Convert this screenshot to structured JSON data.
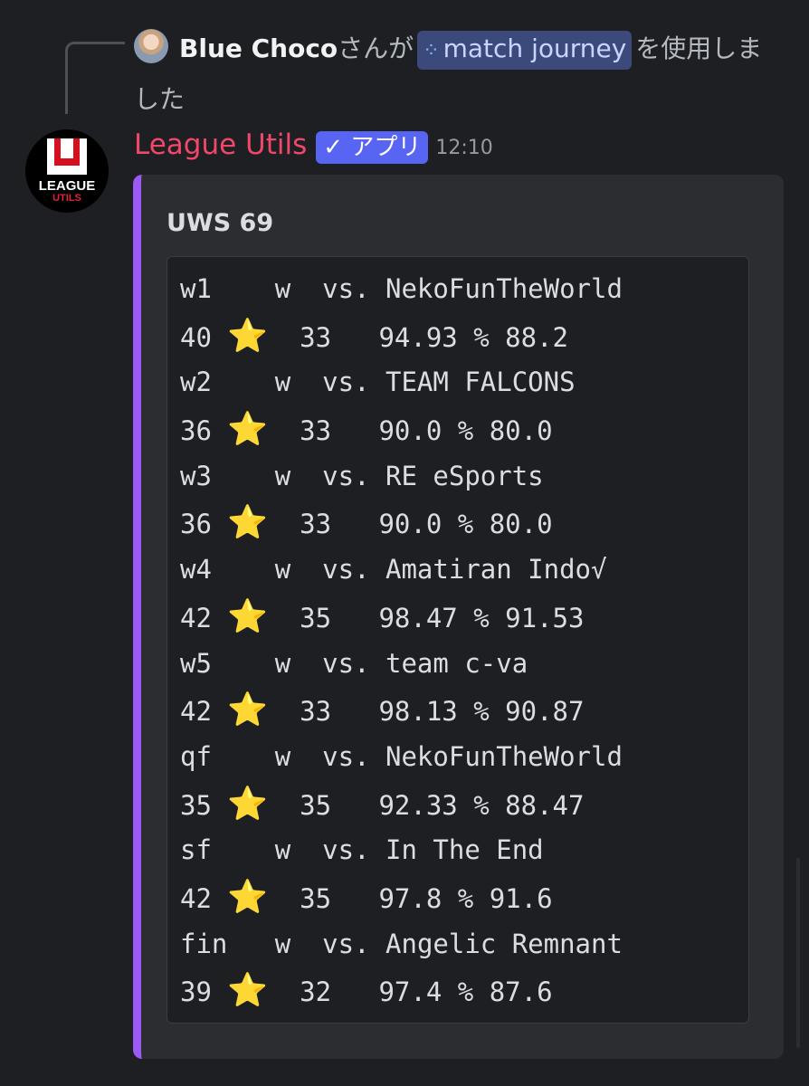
{
  "reply": {
    "avatar_icon": "user-avatar",
    "user": "Blue Choco",
    "prefix": "さんが",
    "command": "match journey",
    "command_icon": "slash-command-icon",
    "suffix": "を使用しました"
  },
  "message": {
    "bot_name": "League Utils",
    "app_tag_check": "✓",
    "app_tag": "アプリ",
    "time": "12:10",
    "avatar_text1": "LEAGUE",
    "avatar_text2": "UTILS",
    "bot_color": "#f0476a"
  },
  "embed": {
    "accent_color": "#9b59f5",
    "title": "UWS 69",
    "star_icon": "⭐",
    "rows": [
      {
        "round": "w1",
        "result": "w",
        "vs": "vs.",
        "opponent": "NekoFunTheWorld",
        "score": "40",
        "second": "33",
        "pct": "94.93 %",
        "last": "88.2"
      },
      {
        "round": "w2",
        "result": "w",
        "vs": "vs.",
        "opponent": "TEAM FALCONS",
        "score": "36",
        "second": "33",
        "pct": "90.0 %",
        "last": "80.0"
      },
      {
        "round": "w3",
        "result": "w",
        "vs": "vs.",
        "opponent": "RE eSports",
        "score": "36",
        "second": "33",
        "pct": "90.0 %",
        "last": "80.0"
      },
      {
        "round": "w4",
        "result": "w",
        "vs": "vs.",
        "opponent": "Amatiran Indo√",
        "score": "42",
        "second": "35",
        "pct": "98.47 %",
        "last": "91.53"
      },
      {
        "round": "w5",
        "result": "w",
        "vs": "vs.",
        "opponent": "team c-va",
        "score": "42",
        "second": "33",
        "pct": "98.13 %",
        "last": "90.87"
      },
      {
        "round": "qf",
        "result": "w",
        "vs": "vs.",
        "opponent": "NekoFunTheWorld",
        "score": "35",
        "second": "35",
        "pct": "92.33 %",
        "last": "88.47"
      },
      {
        "round": "sf",
        "result": "w",
        "vs": "vs.",
        "opponent": "In The End",
        "score": "42",
        "second": "35",
        "pct": "97.8 %",
        "last": "91.6"
      },
      {
        "round": "fin",
        "result": "w",
        "vs": "vs.",
        "opponent": "Angelic Remnant",
        "score": "39",
        "second": "32",
        "pct": "97.4 %",
        "last": "87.6"
      }
    ]
  }
}
